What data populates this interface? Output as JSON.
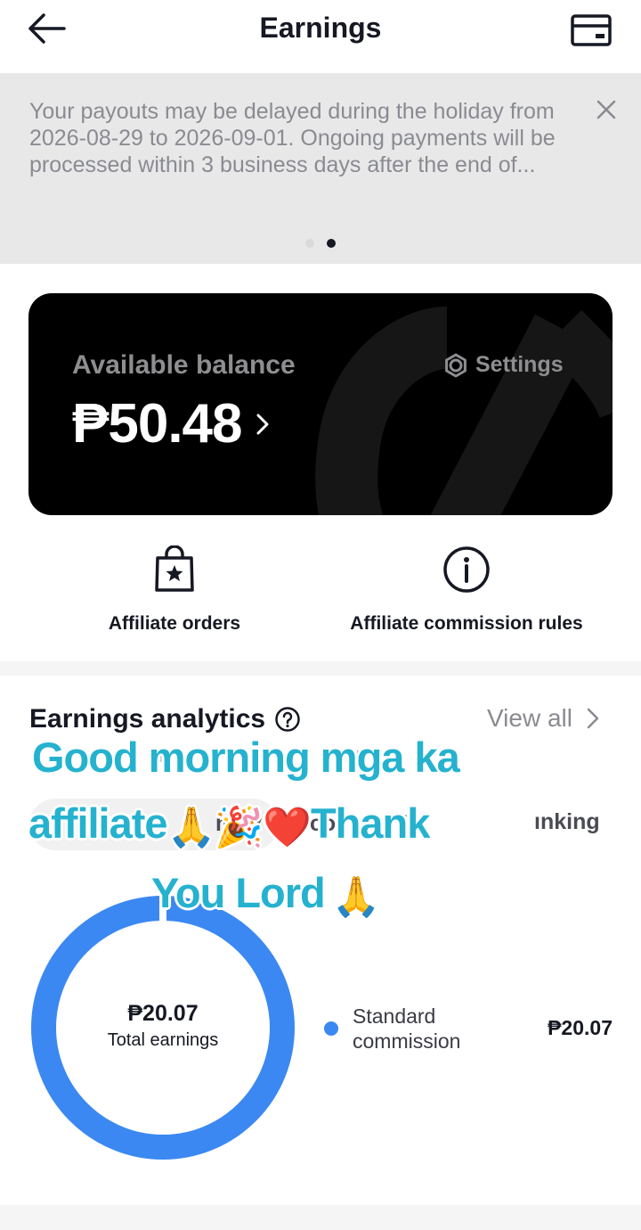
{
  "header": {
    "title": "Earnings",
    "back_icon": "arrow-left-icon",
    "card_icon": "wallet-card-icon"
  },
  "notice": {
    "text": "Your payouts may be delayed during the holiday from 2026-08-29 to 2026-09-01. Ongoing payments will be processed within 3 business days after the end of...",
    "carousel_pages": 2,
    "carousel_active_page": 2
  },
  "balance": {
    "label": "Available balance",
    "value": "₱50.48",
    "settings_label": "Settings",
    "card_color": "#000000"
  },
  "shortcuts": {
    "orders_label": "Affiliate orders",
    "rules_label": "Affiliate commission rules"
  },
  "analytics": {
    "title": "Earnings analytics",
    "view_all": "View all",
    "subtitle_partial": "a",
    "subtitle_partial2": "st",
    "tab_summary_partial": "m",
    "tab_summary_partial2": "y",
    "tab_commission_partial": "co",
    "tab_commission_partial2": "is",
    "tab_ranking_partial": "ınking",
    "total_value": "₱20.07",
    "total_label": "Total earnings",
    "legend_name": "Standard commission",
    "legend_value": "₱20.07",
    "accent_color": "#3b88f2"
  },
  "overlay": {
    "line1": "Good morning mga ka",
    "line2_text_a": "affiliate",
    "line2_text_b": "Thank",
    "line3_text": "You Lord",
    "emoji_pray": "🙏",
    "emoji_party": "🎉",
    "emoji_heart": "❤️",
    "text_color": "#25b2cf"
  }
}
